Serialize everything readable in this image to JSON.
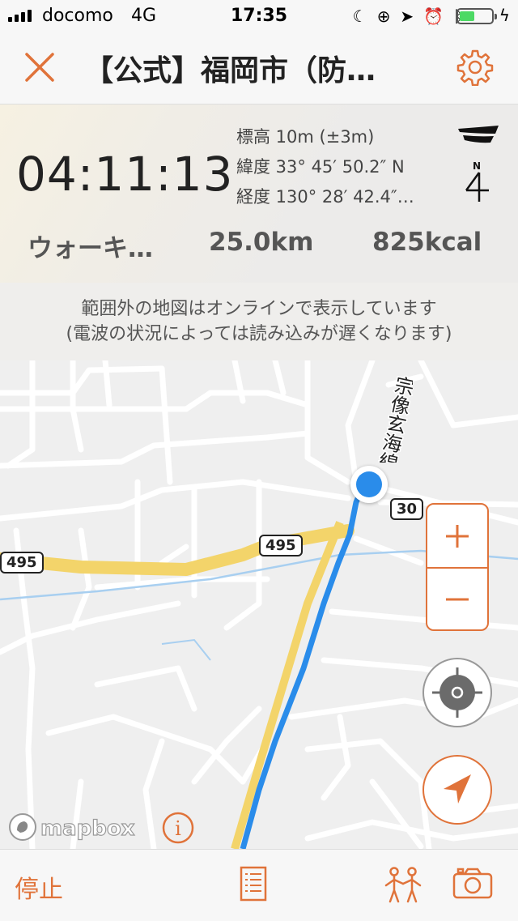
{
  "status_bar": {
    "carrier": "docomo",
    "network": "4G",
    "time": "17:35"
  },
  "nav": {
    "title": "【公式】福岡市（防…"
  },
  "info": {
    "elapsed": "04:11:13",
    "altitude": "標高 10m (±3m)",
    "latitude": "緯度 33° 45′ 50.2″ N",
    "longitude": "経度 130° 28′ 42.4″…",
    "compass_label": "N",
    "activity": "ウォーキ…",
    "distance": "25.0km",
    "calories": "825kcal"
  },
  "notice": {
    "line1": "範囲外の地図はオンラインで表示しています",
    "line2": "(電波の状況によっては読み込みが遅くなります)"
  },
  "map": {
    "route_label": "宗像玄海線",
    "shields": [
      "495",
      "495",
      "30"
    ],
    "attribution": "mapbox",
    "info_symbol": "i"
  },
  "toolbar": {
    "stop_label": "停止"
  },
  "colors": {
    "accent": "#e0733a",
    "track": "#2a8cea",
    "road_major": "#f3d46a"
  }
}
